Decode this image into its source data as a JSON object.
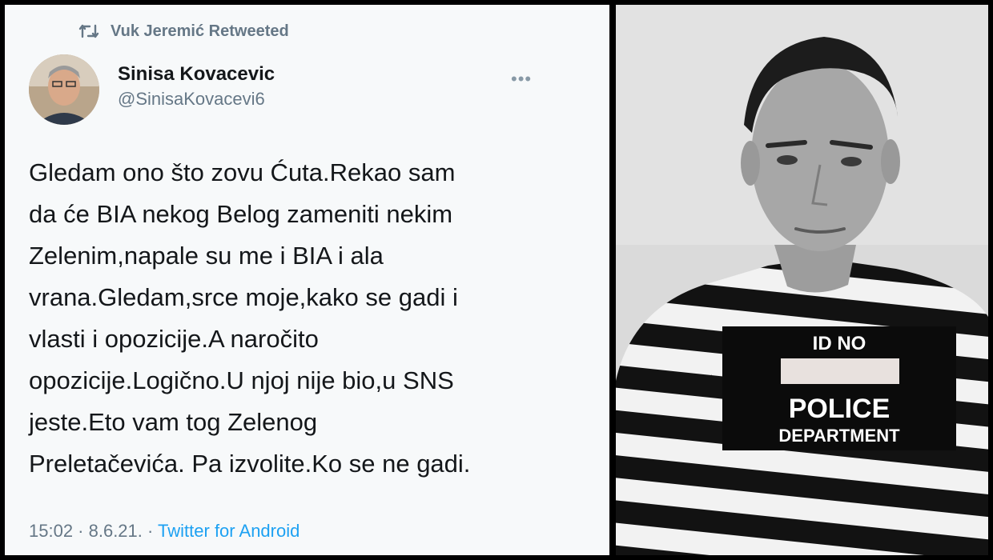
{
  "retweet": {
    "icon": "retweet-icon",
    "label": "Vuk Jeremić Retweeted"
  },
  "author": {
    "name": "Sinisa Kovacevic",
    "handle": "@SinisaKovacevi6"
  },
  "tweet": {
    "text": "Gledam ono što zovu Ćuta.Rekao sam\nda će BIA nekog Belog zameniti nekim\nZelenim,napale su me i BIA i ala\nvrana.Gledam,srce moje,kako se gadi i\nvlasti i opozicije.A naročito\nopozicije.Logično.U njoj nije bio,u SNS\njeste.Eto vam tog Zelenog\nPreletačevića. Pa izvolite.Ko se ne gadi.",
    "time": "15:02 · 8.6.21. · ",
    "source": "Twitter for Android"
  },
  "photo": {
    "sign_line1": "ID NO",
    "sign_line2": "POLICE",
    "sign_line3": "DEPARTMENT"
  },
  "colors": {
    "text": "#14171a",
    "secondary": "#657786",
    "link": "#1da1f2",
    "panel_bg": "#f7f9fa"
  }
}
